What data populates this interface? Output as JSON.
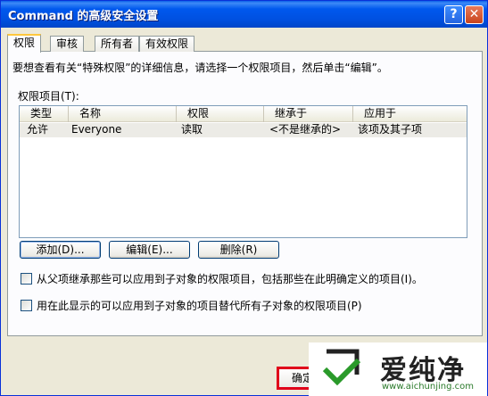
{
  "window": {
    "title": "Command 的高级安全设置"
  },
  "titlebar": {
    "help_glyph": "?",
    "close_glyph": "✕"
  },
  "tabs": [
    {
      "label": "权限"
    },
    {
      "label": "审核"
    },
    {
      "label": "所有者"
    },
    {
      "label": "有效权限"
    }
  ],
  "info_text": "要想查看有关“特殊权限”的详细信息，请选择一个权限项目，然后单击“编辑”。",
  "list_label": "权限项目(T):",
  "columns": [
    "类型",
    "名称",
    "权限",
    "继承于",
    "应用于"
  ],
  "rows": [
    {
      "type": "允许",
      "name": "Everyone",
      "permission": "读取",
      "inherited": "<不是继承的>",
      "applies": "该项及其子项"
    }
  ],
  "buttons": {
    "add": "添加(D)...",
    "edit": "编辑(E)...",
    "remove": "删除(R)"
  },
  "checkboxes": {
    "inherit": "从父项继承那些可以应用到子对象的权限项目，包括那些在此明确定义的项目(I)。",
    "replace": "用在此显示的可以应用到子对象的项目替代所有子对象的权限项目(P)"
  },
  "ok_button": "确定",
  "watermark": {
    "text": "爱纯净",
    "url": "www.aichunjing.com"
  },
  "colors": {
    "titlebar": "#0058ee",
    "highlight_border": "#e0001a",
    "tab_accent": "#ffc83c"
  }
}
